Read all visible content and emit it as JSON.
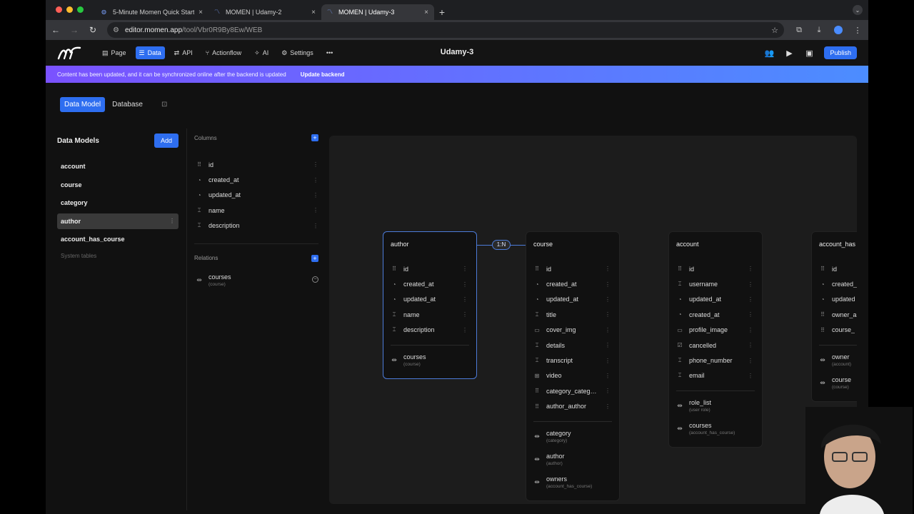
{
  "browser": {
    "tabs": [
      {
        "title": "5-Minute Momen Quick Start",
        "active": false
      },
      {
        "title": "MOMEN | Udamy-2",
        "active": false
      },
      {
        "title": "MOMEN | Udamy-3",
        "active": true
      }
    ],
    "url_host": "editor.momen.app",
    "url_path": "/tool/Vbr0R9By8Ew/WEB"
  },
  "app": {
    "menu": [
      {
        "label": "Page",
        "icon": "page-icon",
        "active": false
      },
      {
        "label": "Data",
        "icon": "data-icon",
        "active": true
      },
      {
        "label": "API",
        "icon": "api-icon",
        "active": false
      },
      {
        "label": "Actionflow",
        "icon": "actionflow-icon",
        "active": false
      },
      {
        "label": "AI",
        "icon": "ai-icon",
        "active": false
      },
      {
        "label": "Settings",
        "icon": "gear-icon",
        "active": false
      }
    ],
    "title": "Udamy-3",
    "publish_label": "Publish"
  },
  "banner": {
    "message": "Content has been updated, and it can be synchronized online after the backend is updated",
    "action": "Update backend"
  },
  "subtabs": {
    "data_model": "Data Model",
    "database": "Database"
  },
  "sidebar": {
    "title": "Data Models",
    "add_label": "Add",
    "models": [
      "account",
      "course",
      "category",
      "author",
      "account_has_course"
    ],
    "selected": "author",
    "system_tables": "System tables"
  },
  "columns_panel": {
    "columns_title": "Columns",
    "columns": [
      {
        "name": "id",
        "icon": "id-icon"
      },
      {
        "name": "created_at",
        "icon": "clock-icon"
      },
      {
        "name": "updated_at",
        "icon": "clock-icon"
      },
      {
        "name": "name",
        "icon": "text-icon"
      },
      {
        "name": "description",
        "icon": "text-icon"
      }
    ],
    "relations_title": "Relations",
    "relations": [
      {
        "name": "courses",
        "target": "(course)"
      }
    ]
  },
  "canvas": {
    "relation_badge": "1:N",
    "tables": [
      {
        "name": "author",
        "fields": [
          {
            "name": "id",
            "icon": "id-icon"
          },
          {
            "name": "created_at",
            "icon": "clock-icon"
          },
          {
            "name": "updated_at",
            "icon": "clock-icon"
          },
          {
            "name": "name",
            "icon": "text-icon"
          },
          {
            "name": "description",
            "icon": "text-icon"
          }
        ],
        "relations": [
          {
            "name": "courses",
            "target": "(course)"
          }
        ]
      },
      {
        "name": "course",
        "fields": [
          {
            "name": "id",
            "icon": "id-icon"
          },
          {
            "name": "created_at",
            "icon": "clock-icon"
          },
          {
            "name": "updated_at",
            "icon": "clock-icon"
          },
          {
            "name": "title",
            "icon": "text-icon"
          },
          {
            "name": "cover_img",
            "icon": "image-icon"
          },
          {
            "name": "details",
            "icon": "text-icon"
          },
          {
            "name": "transcript",
            "icon": "text-icon"
          },
          {
            "name": "video",
            "icon": "video-icon"
          },
          {
            "name": "category_catego...",
            "icon": "id-icon"
          },
          {
            "name": "author_author",
            "icon": "id-icon"
          }
        ],
        "relations": [
          {
            "name": "category",
            "target": "(category)"
          },
          {
            "name": "author",
            "target": "(author)"
          },
          {
            "name": "owners",
            "target": "(account_has_course)"
          }
        ]
      },
      {
        "name": "account",
        "fields": [
          {
            "name": "id",
            "icon": "id-icon"
          },
          {
            "name": "username",
            "icon": "text-icon"
          },
          {
            "name": "updated_at",
            "icon": "clock-icon"
          },
          {
            "name": "created_at",
            "icon": "clock-icon"
          },
          {
            "name": "profile_image",
            "icon": "image-icon"
          },
          {
            "name": "cancelled",
            "icon": "checkbox-icon"
          },
          {
            "name": "phone_number",
            "icon": "text-icon"
          },
          {
            "name": "email",
            "icon": "text-icon"
          }
        ],
        "relations": [
          {
            "name": "role_list",
            "target": "(user role)"
          },
          {
            "name": "courses",
            "target": "(account_has_course)"
          }
        ]
      },
      {
        "name": "account_has",
        "fields": [
          {
            "name": "id",
            "icon": "id-icon"
          },
          {
            "name": "created_",
            "icon": "clock-icon"
          },
          {
            "name": "updated",
            "icon": "clock-icon"
          },
          {
            "name": "owner_a",
            "icon": "id-icon"
          },
          {
            "name": "course_",
            "icon": "id-icon"
          }
        ],
        "relations": [
          {
            "name": "owner",
            "target": "(account)"
          },
          {
            "name": "course",
            "target": "(course)"
          }
        ]
      }
    ]
  },
  "colors": {
    "accent": "#2e6ef0",
    "selection": "#4c7bd9",
    "banner_start": "#7a52ff",
    "banner_end": "#4c8dff"
  }
}
